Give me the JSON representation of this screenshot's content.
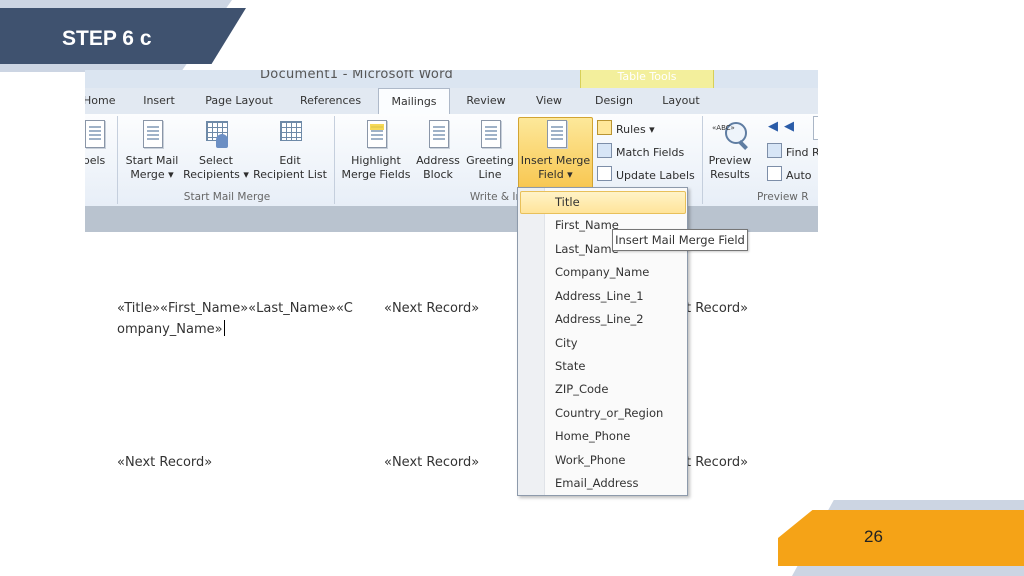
{
  "slide": {
    "step_label": "STEP 6 c",
    "page_number": "26"
  },
  "word": {
    "window_title": "Document1 - Microsoft Word",
    "context_tab_group": "Table Tools",
    "tabs": [
      "Home",
      "Insert",
      "Page Layout",
      "References",
      "Mailings",
      "Review",
      "View",
      "Design",
      "Layout"
    ],
    "active_tab": "Mailings",
    "ribbon": {
      "labels_partial": "bels",
      "start_mail_merge": [
        "Start Mail",
        "Merge ▾"
      ],
      "select_recipients": [
        "Select",
        "Recipients ▾"
      ],
      "edit_recipient_list": [
        "Edit",
        "Recipient List"
      ],
      "highlight_merge_fields": [
        "Highlight",
        "Merge Fields"
      ],
      "address_block": [
        "Address",
        "Block"
      ],
      "greeting_line": [
        "Greeting",
        "Line"
      ],
      "insert_merge_field": [
        "Insert Merge",
        "Field ▾"
      ],
      "rules": "Rules ▾",
      "match_fields": "Match Fields",
      "update_labels": "Update Labels",
      "preview_results": [
        "Preview",
        "Results"
      ],
      "preview_icon_text": "«ABC»",
      "find_recipient": "Find R",
      "auto_check": "Auto",
      "group_start_mail_merge": "Start Mail Merge",
      "group_write_insert": "Write & In",
      "group_preview": "Preview R"
    },
    "document": {
      "line1_col1": "«Title»«First_Name»«Last_Name»«C",
      "line2_col1": "ompany_Name»",
      "line1_col2": "«Next Record»",
      "line1_col3": "t Record»",
      "line3_col1": "«Next Record»",
      "line3_col2": "«Next Record»",
      "line3_col3": "t Record»"
    },
    "merge_field_menu": [
      "Title",
      "First_Name",
      "Last_Name",
      "Company_Name",
      "Address_Line_1",
      "Address_Line_2",
      "City",
      "State",
      "ZIP_Code",
      "Country_or_Region",
      "Home_Phone",
      "Work_Phone",
      "Email_Address"
    ],
    "highlighted_field": "Title",
    "tooltip": "Insert Mail Merge Field"
  },
  "colors": {
    "step_banner": "#3f526f",
    "banner_light": "#ccd5e3",
    "page_banner": "#f5a317",
    "ribbon_highlight": "#f8c64f"
  }
}
